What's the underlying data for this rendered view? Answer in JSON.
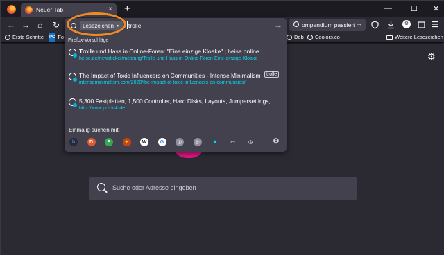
{
  "window": {
    "tab_title": "Neuer Tab",
    "tab_close": "×",
    "new_tab": "+",
    "minimize": "—",
    "maximize": "☐",
    "close": "✕"
  },
  "toolbar": {
    "back": "←",
    "forward": "→",
    "home": "⌂",
    "reload": "↻",
    "second_search_text": "ompendium passiert",
    "second_search_go": "→",
    "icons": [
      "shield-icon",
      "download-icon",
      "profile-icon",
      "menu-icon"
    ]
  },
  "urlbar": {
    "chip_label": "Lesezeichen",
    "chip_close": "×",
    "typed_text": "trolle",
    "go_arrow": "→",
    "suggestions_header": "Firefox-Vorschläge",
    "suggestions": [
      {
        "title_bold": "Trolle",
        "title_rest": " und Hass in Online-Foren: \"Eine einzige Kloake\" | heise online",
        "url": "heise.de/newsticker/meldung/Trolle-und-Hass-in-Online-Foren-Eine-einzige-Kloake",
        "tag": ""
      },
      {
        "title_bold": "",
        "title_rest": "The Impact of Toxic Influencers on Communities - Intense Minimalism",
        "url": "intenseminimalism.com/2020/the-impact-of-toxic-influencers-on-communities/",
        "tag": "trolle"
      },
      {
        "title_bold": "",
        "title_rest": "5,300 Festplatten, 1,500 Controller, Hard Disks, Layouts, Jumpersettings,",
        "url": "http://www.pc-disk.de",
        "tag": ""
      }
    ],
    "once_label": "Einmalig suchen mit:",
    "engines": [
      {
        "name": "bing-icon",
        "glyph": "b",
        "color": "#2b2a33",
        "fg": "#2a8bf2"
      },
      {
        "name": "duckduckgo-icon",
        "glyph": "D",
        "color": "#de5833",
        "fg": "#ffffff"
      },
      {
        "name": "ecosia-icon",
        "glyph": "E",
        "color": "#36a852",
        "fg": "#ffffff"
      },
      {
        "name": "bookmark-site-icon",
        "glyph": "✦",
        "color": "#c8421a",
        "fg": "#ffd400"
      },
      {
        "name": "wikipedia-icon",
        "glyph": "W",
        "color": "#ffffff",
        "fg": "#000000"
      },
      {
        "name": "google-icon",
        "glyph": "G",
        "color": "#ffffff",
        "fg": "#4285f4"
      },
      {
        "name": "search-engine-icon",
        "glyph": "◎",
        "color": "#8f8f9d",
        "fg": "#ffffff"
      },
      {
        "name": "search-engine-2-icon",
        "glyph": "◎",
        "color": "#8f8f9d",
        "fg": "#ffffff"
      },
      {
        "name": "bookmarks-star-icon",
        "glyph": "★",
        "color": "#42414d",
        "fg": "#00ddff"
      },
      {
        "name": "tabs-icon",
        "glyph": "▭",
        "color": "#42414d",
        "fg": "#fbfbfe"
      },
      {
        "name": "history-icon",
        "glyph": "◷",
        "color": "#42414d",
        "fg": "#fbfbfe"
      }
    ],
    "settings_glyph": "⚙"
  },
  "bookmarks": {
    "items": [
      "Erste Schritte",
      "Fo",
      "Deb",
      "Coolors.co"
    ],
    "other_folder": "Weitere Lesezeichen",
    "pc_badge": "PC"
  },
  "content": {
    "search_placeholder": "Suche oder Adresse eingeben",
    "settings_glyph": "⚙"
  },
  "colors": {
    "accent_ring": "#f08a24",
    "url_link": "#00ddff",
    "brand_pink": "#e31587"
  }
}
